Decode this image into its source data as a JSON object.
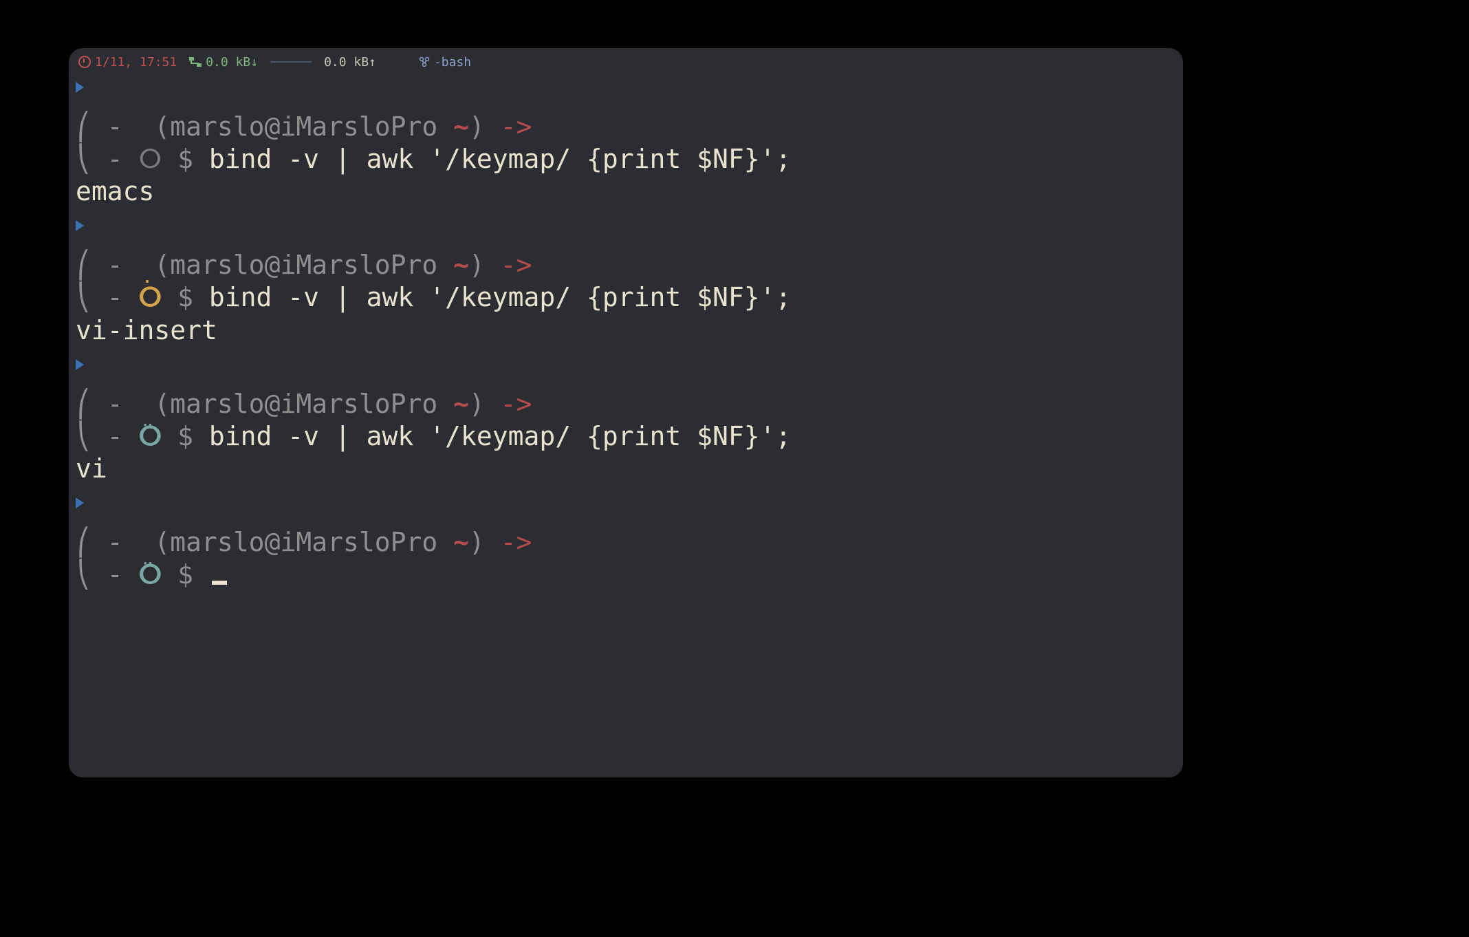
{
  "titlebar": {
    "date": "1/11, 17:51",
    "net_down": "0.0 kB↓",
    "net_up": "0.0 kB↑",
    "process": "-bash"
  },
  "prompt": {
    "user_host": "marslo@iMarsloPro",
    "tilde": "~",
    "arrow": "->",
    "dollar": "$",
    "bracket_top": "⎛ -",
    "bracket_bot": "⎝ -",
    "open_paren": "(",
    "close_paren": ")"
  },
  "glyphs": {
    "chest": "ⵔ",
    "dots2": "‥",
    "dot1": "·"
  },
  "blocks": [
    {
      "icon_style": "plain",
      "command": "bind -v | awk '/keymap/ {print $NF}';",
      "output": "emacs"
    },
    {
      "icon_style": "gold",
      "command": "bind -v | awk '/keymap/ {print $NF}';",
      "output": "vi-insert"
    },
    {
      "icon_style": "teal",
      "command": "bind -v | awk '/keymap/ {print $NF}';",
      "output": "vi"
    },
    {
      "icon_style": "teal",
      "command": "",
      "output": null,
      "cursor": true
    }
  ]
}
